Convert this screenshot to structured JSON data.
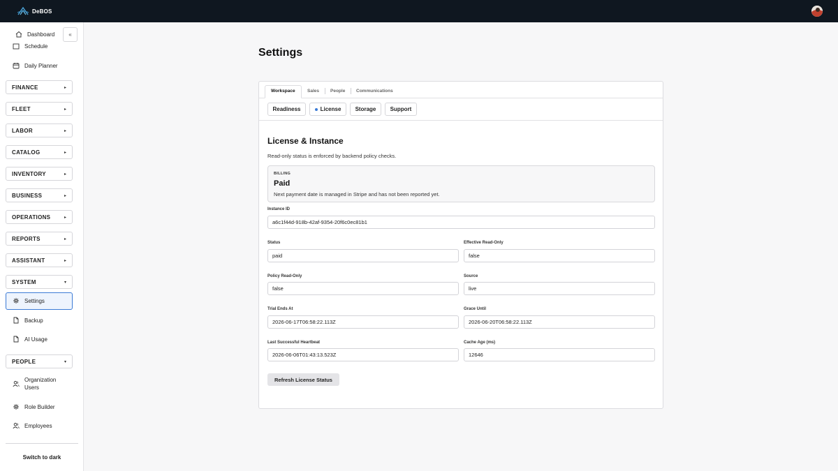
{
  "app": {
    "brand_name": "DeBOS"
  },
  "sidebar": {
    "collapse_label": "«",
    "dashboard_label": "Dashboard",
    "schedule_label": "Schedule",
    "daily_planner_label": "Daily Planner",
    "groups": {
      "finance": "FINANCE",
      "fleet": "FLEET",
      "labor": "LABOR",
      "catalog": "CATALOG",
      "inventory": "INVENTORY",
      "business": "BUSINESS",
      "operations": "OPERATIONS",
      "reports": "REPORTS",
      "assistant": "ASSISTANT",
      "system": "SYSTEM",
      "people": "PEOPLE"
    },
    "chevron_collapsed": "▸",
    "chevron_expanded": "▾",
    "system_items": {
      "settings": "Settings",
      "backup": "Backup",
      "ai_usage": "AI Usage"
    },
    "people_items": {
      "org_users": "Organization Users",
      "role_builder": "Role Builder",
      "employees": "Employees"
    },
    "theme_toggle": "Switch to dark"
  },
  "main": {
    "page_title": "Settings",
    "tabs": {
      "workspace": "Workspace",
      "sales": "Sales",
      "people": "People",
      "communications": "Communications"
    },
    "subtabs": {
      "readiness": "Readiness",
      "license": "License",
      "storage": "Storage",
      "support": "Support"
    },
    "section_title": "License & Instance",
    "section_desc": "Read-only status is enforced by backend policy checks.",
    "billing": {
      "label": "BILLING",
      "value": "Paid",
      "note": "Next payment date is managed in Stripe and has not been reported yet."
    },
    "fields": {
      "instance_id": {
        "label": "Instance ID",
        "value": "a6c1f44d-918b-42af-9354-20f6c0ec81b1"
      },
      "status": {
        "label": "Status",
        "value": "paid"
      },
      "effective_read_only": {
        "label": "Effective Read-Only",
        "value": "false"
      },
      "policy_read_only": {
        "label": "Policy Read-Only",
        "value": "false"
      },
      "source": {
        "label": "Source",
        "value": "live"
      },
      "trial_ends_at": {
        "label": "Trial Ends At",
        "value": "2026-06-17T06:58:22.113Z"
      },
      "grace_until": {
        "label": "Grace Until",
        "value": "2026-06-20T06:58:22.113Z"
      },
      "last_heartbeat": {
        "label": "Last Successful Heartbeat",
        "value": "2026-06-06T01:43:13.523Z"
      },
      "cache_age": {
        "label": "Cache Age (ms)",
        "value": "12646"
      }
    },
    "refresh_button": "Refresh License Status"
  },
  "colors": {
    "topbar": "#0f1720",
    "accent": "#3b7bd6"
  }
}
